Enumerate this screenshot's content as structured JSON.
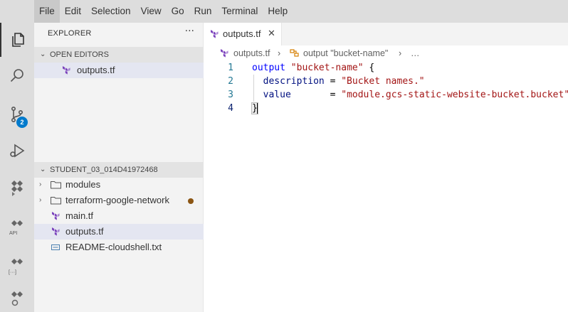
{
  "menu": {
    "items": [
      "File",
      "Edit",
      "Selection",
      "View",
      "Go",
      "Run",
      "Terminal",
      "Help"
    ]
  },
  "activity": {
    "source_control_badge": "2",
    "api_label": "API",
    "brackets_label": "[···]"
  },
  "explorer": {
    "title": "EXPLORER",
    "more": "···",
    "open_editors": {
      "header": "OPEN EDITORS",
      "items": [
        {
          "label": "outputs.tf",
          "icon": "terraform-icon"
        }
      ]
    },
    "workspace": {
      "header": "STUDENT_03_014D41972468",
      "items": [
        {
          "label": "modules",
          "type": "folder"
        },
        {
          "label": "terraform-google-network",
          "type": "folder"
        },
        {
          "label": "main.tf",
          "type": "file"
        },
        {
          "label": "outputs.tf",
          "type": "file"
        },
        {
          "label": "README-cloudshell.txt",
          "type": "file"
        }
      ]
    }
  },
  "tabs": [
    {
      "label": "outputs.tf",
      "close": "✕"
    }
  ],
  "breadcrumb": {
    "file": "outputs.tf",
    "symbol": "output \"bucket-name\"",
    "ellipsis": "…",
    "sep": "›"
  },
  "code": {
    "line_numbers": [
      "1",
      "2",
      "3",
      "4"
    ],
    "l1_kw": "output",
    "l1_name": "\"bucket-name\"",
    "l1_brace": "{",
    "l2_attr": "description",
    "l2_eq": " = ",
    "l2_val": "\"Bucket names.\"",
    "l3_attr": "value",
    "l3_eq": "       = ",
    "l3_val": "\"module.gcs-static-website-bucket.bucket\"",
    "l4_brace": "}"
  }
}
